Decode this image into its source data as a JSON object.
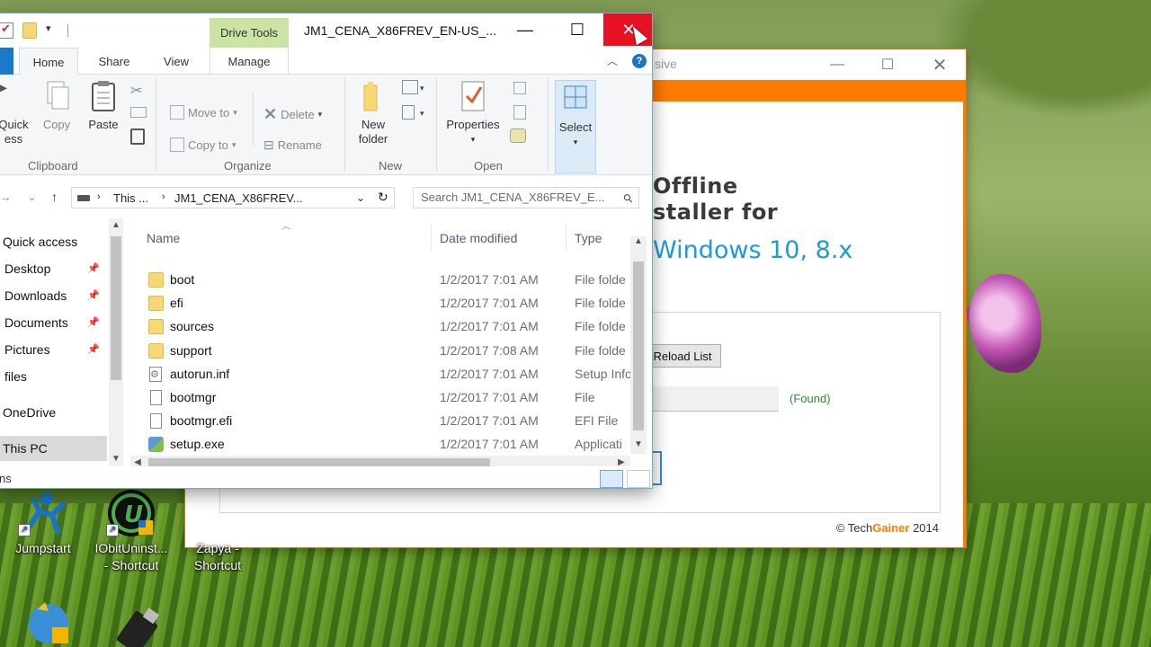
{
  "explorer": {
    "title": "JM1_CENA_X86FREV_EN-US_...",
    "context_tab": "Drive Tools",
    "tabs": {
      "home": "Home",
      "share": "Share",
      "view": "View",
      "manage": "Manage"
    },
    "ribbon": {
      "clipboard": {
        "label": "Clipboard",
        "quick_access_1": "Quick",
        "quick_access_2": "ess",
        "copy": "Copy",
        "paste": "Paste"
      },
      "organize": {
        "label": "Organize",
        "move_to": "Move to",
        "copy_to": "Copy to",
        "delete": "Delete",
        "rename": "Rename"
      },
      "new": {
        "label": "New",
        "new_folder_1": "New",
        "new_folder_2": "folder"
      },
      "open": {
        "label": "Open",
        "properties": "Properties"
      },
      "select": {
        "label": "Select"
      }
    },
    "address": {
      "crumb1": "This ...",
      "crumb2": "JM1_CENA_X86FREV..."
    },
    "search_placeholder": "Search JM1_CENA_X86FREV_E...",
    "nav": {
      "quick_access": "Quick access",
      "desktop": "Desktop",
      "downloads": "Downloads",
      "documents": "Documents",
      "pictures": "Pictures",
      "files": "files",
      "onedrive": "OneDrive",
      "this_pc": "This PC"
    },
    "columns": {
      "name": "Name",
      "date": "Date modified",
      "type": "Type"
    },
    "rows": [
      {
        "name": "boot",
        "date": "1/2/2017 7:01 AM",
        "type": "File folde",
        "icon": "folder"
      },
      {
        "name": "efi",
        "date": "1/2/2017 7:01 AM",
        "type": "File folde",
        "icon": "folder"
      },
      {
        "name": "sources",
        "date": "1/2/2017 7:01 AM",
        "type": "File folde",
        "icon": "folder"
      },
      {
        "name": "support",
        "date": "1/2/2017 7:08 AM",
        "type": "File folde",
        "icon": "folder"
      },
      {
        "name": "autorun.inf",
        "date": "1/2/2017 7:01 AM",
        "type": "Setup Info",
        "icon": "inf"
      },
      {
        "name": "bootmgr",
        "date": "1/2/2017 7:01 AM",
        "type": "File",
        "icon": "file"
      },
      {
        "name": "bootmgr.efi",
        "date": "1/2/2017 7:01 AM",
        "type": "EFI File",
        "icon": "file"
      },
      {
        "name": "setup.exe",
        "date": "1/2/2017 7:01 AM",
        "type": "Applicati",
        "icon": "exe"
      }
    ],
    "status_text": "ns"
  },
  "app": {
    "title_fragment": "sive",
    "heading_line1": "Offline",
    "heading_line2": "staller for",
    "windows_text": "Windows",
    "windows_version": " 10, 8.x",
    "reload_button": "Reload List",
    "found_text": "(Found)",
    "copyright_prefix": "© Tech",
    "copyright_brand": "Gainer",
    "copyright_year": " 2014"
  },
  "desktop": {
    "icons": [
      {
        "label1": "Jumpstart",
        "label2": ""
      },
      {
        "label1": "IObitUninst...",
        "label2": "- Shortcut"
      },
      {
        "label1": "Zapya -",
        "label2": "Shortcut"
      }
    ]
  },
  "colors": {
    "accent_orange": "#ff7a00",
    "close_red": "#e81123",
    "explorer_blue": "#1979ca"
  }
}
